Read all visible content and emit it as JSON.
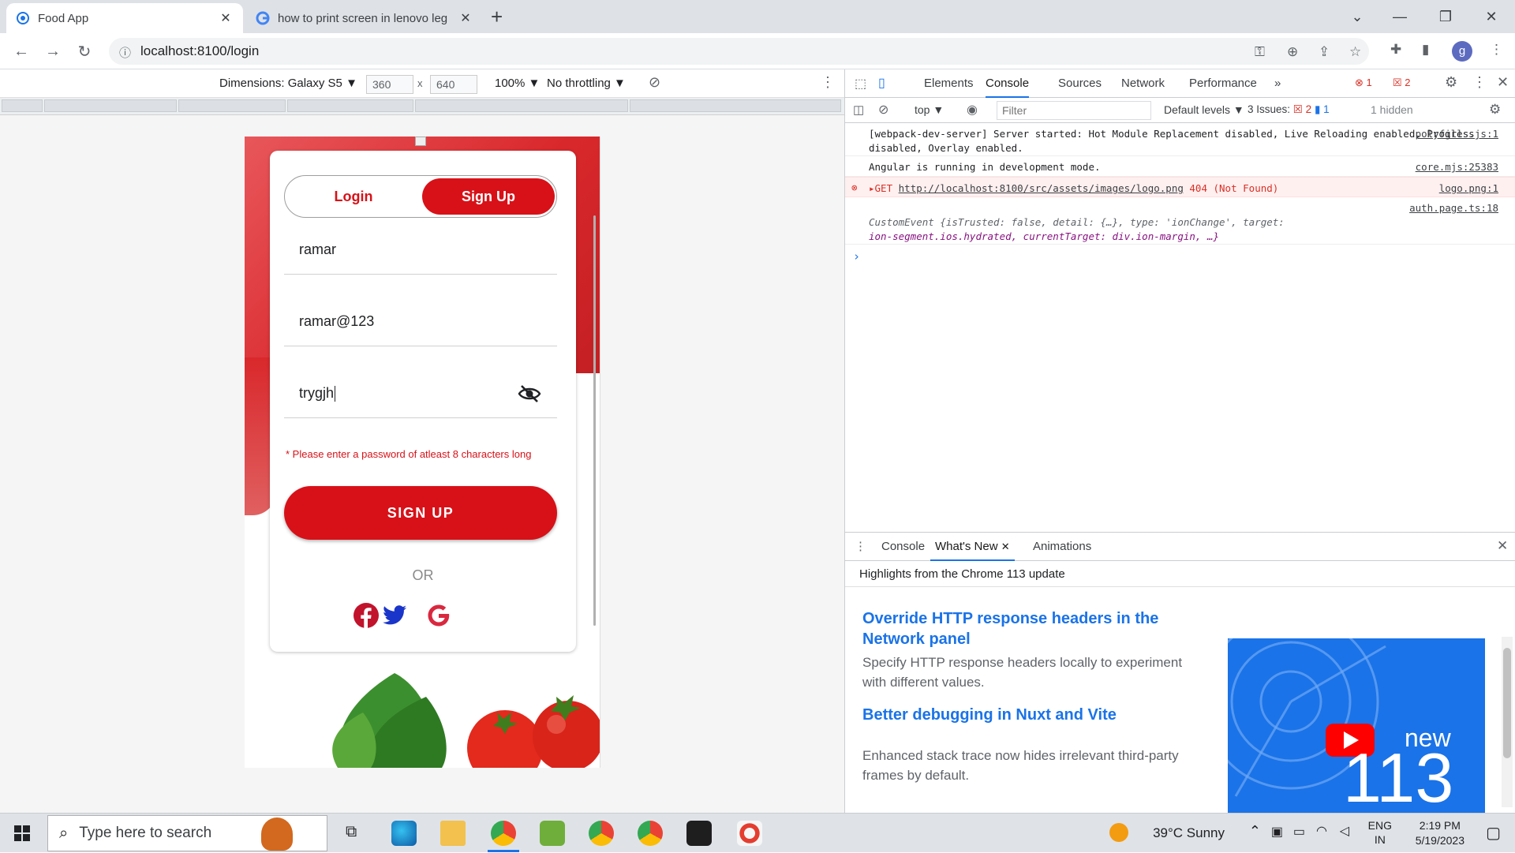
{
  "browser": {
    "tabs": [
      {
        "title": "Food App",
        "icon": "chrome-loading-icon",
        "active": true
      },
      {
        "title": "how to print screen in lenovo leg",
        "icon": "google-icon",
        "active": false
      }
    ],
    "new_tab_glyph": "+",
    "url": "localhost:8100/login",
    "profile_initial": "g"
  },
  "device_toolbar": {
    "dimensions_label": "Dimensions: Galaxy S5 ▼",
    "width": "360",
    "height": "640",
    "times": "x",
    "zoom": "100% ▼",
    "throttling": "No throttling ▼"
  },
  "app": {
    "segment": {
      "login": "Login",
      "signup": "Sign Up",
      "selected": "signup"
    },
    "fields": [
      {
        "name": "username",
        "value": "ramar"
      },
      {
        "name": "email",
        "value": "ramar@123"
      },
      {
        "name": "password",
        "value": "trygjh"
      }
    ],
    "error": "* Please enter a password of atleast 8 characters long",
    "submit": "SIGN UP",
    "or": "OR",
    "brand_color": "#d81118"
  },
  "devtools": {
    "tabs": [
      "Elements",
      "Console",
      "Sources",
      "Network",
      "Performance",
      "»"
    ],
    "active_tab": "Console",
    "error_count": "1",
    "issue_badge": "2",
    "context": "top ▼",
    "filter_placeholder": "Filter",
    "levels": "Default levels ▼",
    "issues_label": "3 Issues:",
    "issues_err": "2",
    "issues_info": "1",
    "hidden": "1 hidden",
    "console": [
      {
        "text": "[webpack-dev-server] Server started: Hot Module Replacement disabled, Live Reloading enabled, Progress disabled, Overlay enabled.",
        "source": "polyfills.js:1"
      },
      {
        "text": "Angular is running in development mode.",
        "source": "core.mjs:25383"
      },
      {
        "method": "▸GET",
        "link": "http://localhost:8100/src/assets/images/logo.png",
        "status": "404 (Not Found)",
        "source": "logo.png:1"
      },
      {
        "source": "auth.page.ts:18",
        "text1": "CustomEvent {isTrusted: false, detail: {…}, type: 'ionChange', target:",
        "text2": "ion-segment.ios.hydrated, currentTarget: div.ion-margin, …}"
      }
    ],
    "prompt": "›",
    "drawer": {
      "tabs": [
        "Console",
        "What's New",
        "Animations"
      ],
      "active": "What's New",
      "highlights": "Highlights from the Chrome 113 update",
      "items": [
        {
          "title": "Override HTTP response headers in the Network panel",
          "desc": "Specify HTTP response headers locally to experiment with different values."
        },
        {
          "title": "Better debugging in Nuxt and Vite",
          "desc": "Enhanced stack trace now hides irrelevant third-party frames by default."
        }
      ],
      "banner_new": "new",
      "banner_version": "113"
    }
  },
  "taskbar": {
    "search_placeholder": "Type here to search",
    "weather": "39°C  Sunny",
    "lang1": "ENG",
    "lang2": "IN",
    "time": "2:19 PM",
    "date": "5/19/2023"
  }
}
